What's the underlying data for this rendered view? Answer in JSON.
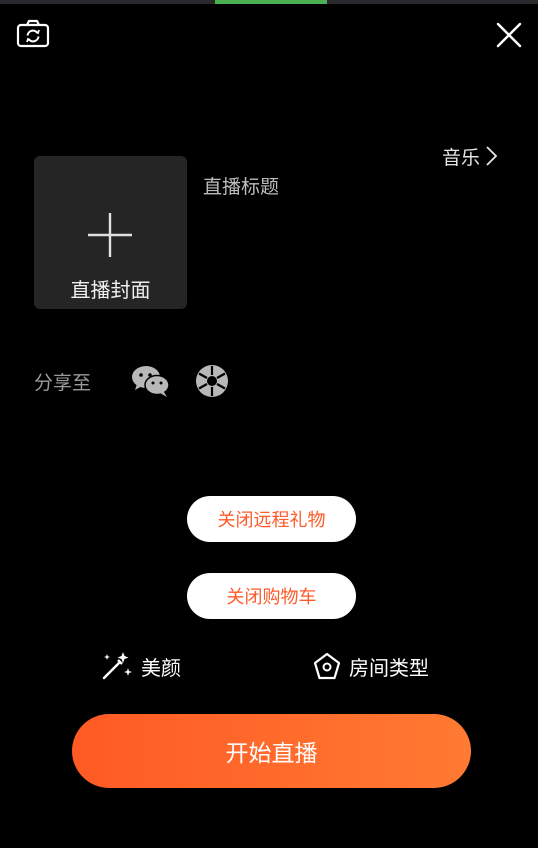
{
  "top_bar": {
    "camera_icon": "camera-flip-icon",
    "close_icon": "close-icon"
  },
  "music": {
    "label": "音乐",
    "icon": "chevron-right-icon"
  },
  "cover": {
    "label": "直播封面",
    "icon": "plus-icon"
  },
  "title": {
    "placeholder": "直播标题"
  },
  "share": {
    "label": "分享至",
    "targets": [
      "wechat-icon",
      "moments-icon"
    ]
  },
  "toggles": {
    "remote_gifts_label": "关闭远程礼物",
    "shopping_cart_label": "关闭购物车"
  },
  "options": {
    "beauty_label": "美颜",
    "beauty_icon": "magic-wand-icon",
    "room_type_label": "房间类型",
    "room_type_icon": "pentagon-home-icon"
  },
  "start_button": {
    "label": "开始直播"
  },
  "colors": {
    "background": "#000000",
    "accent": "#ff5a29",
    "start_gradient_start": "#ff5a24",
    "start_gradient_end": "#ff7a32",
    "cover_bg": "#252525",
    "status_accent": "#4caf50"
  }
}
